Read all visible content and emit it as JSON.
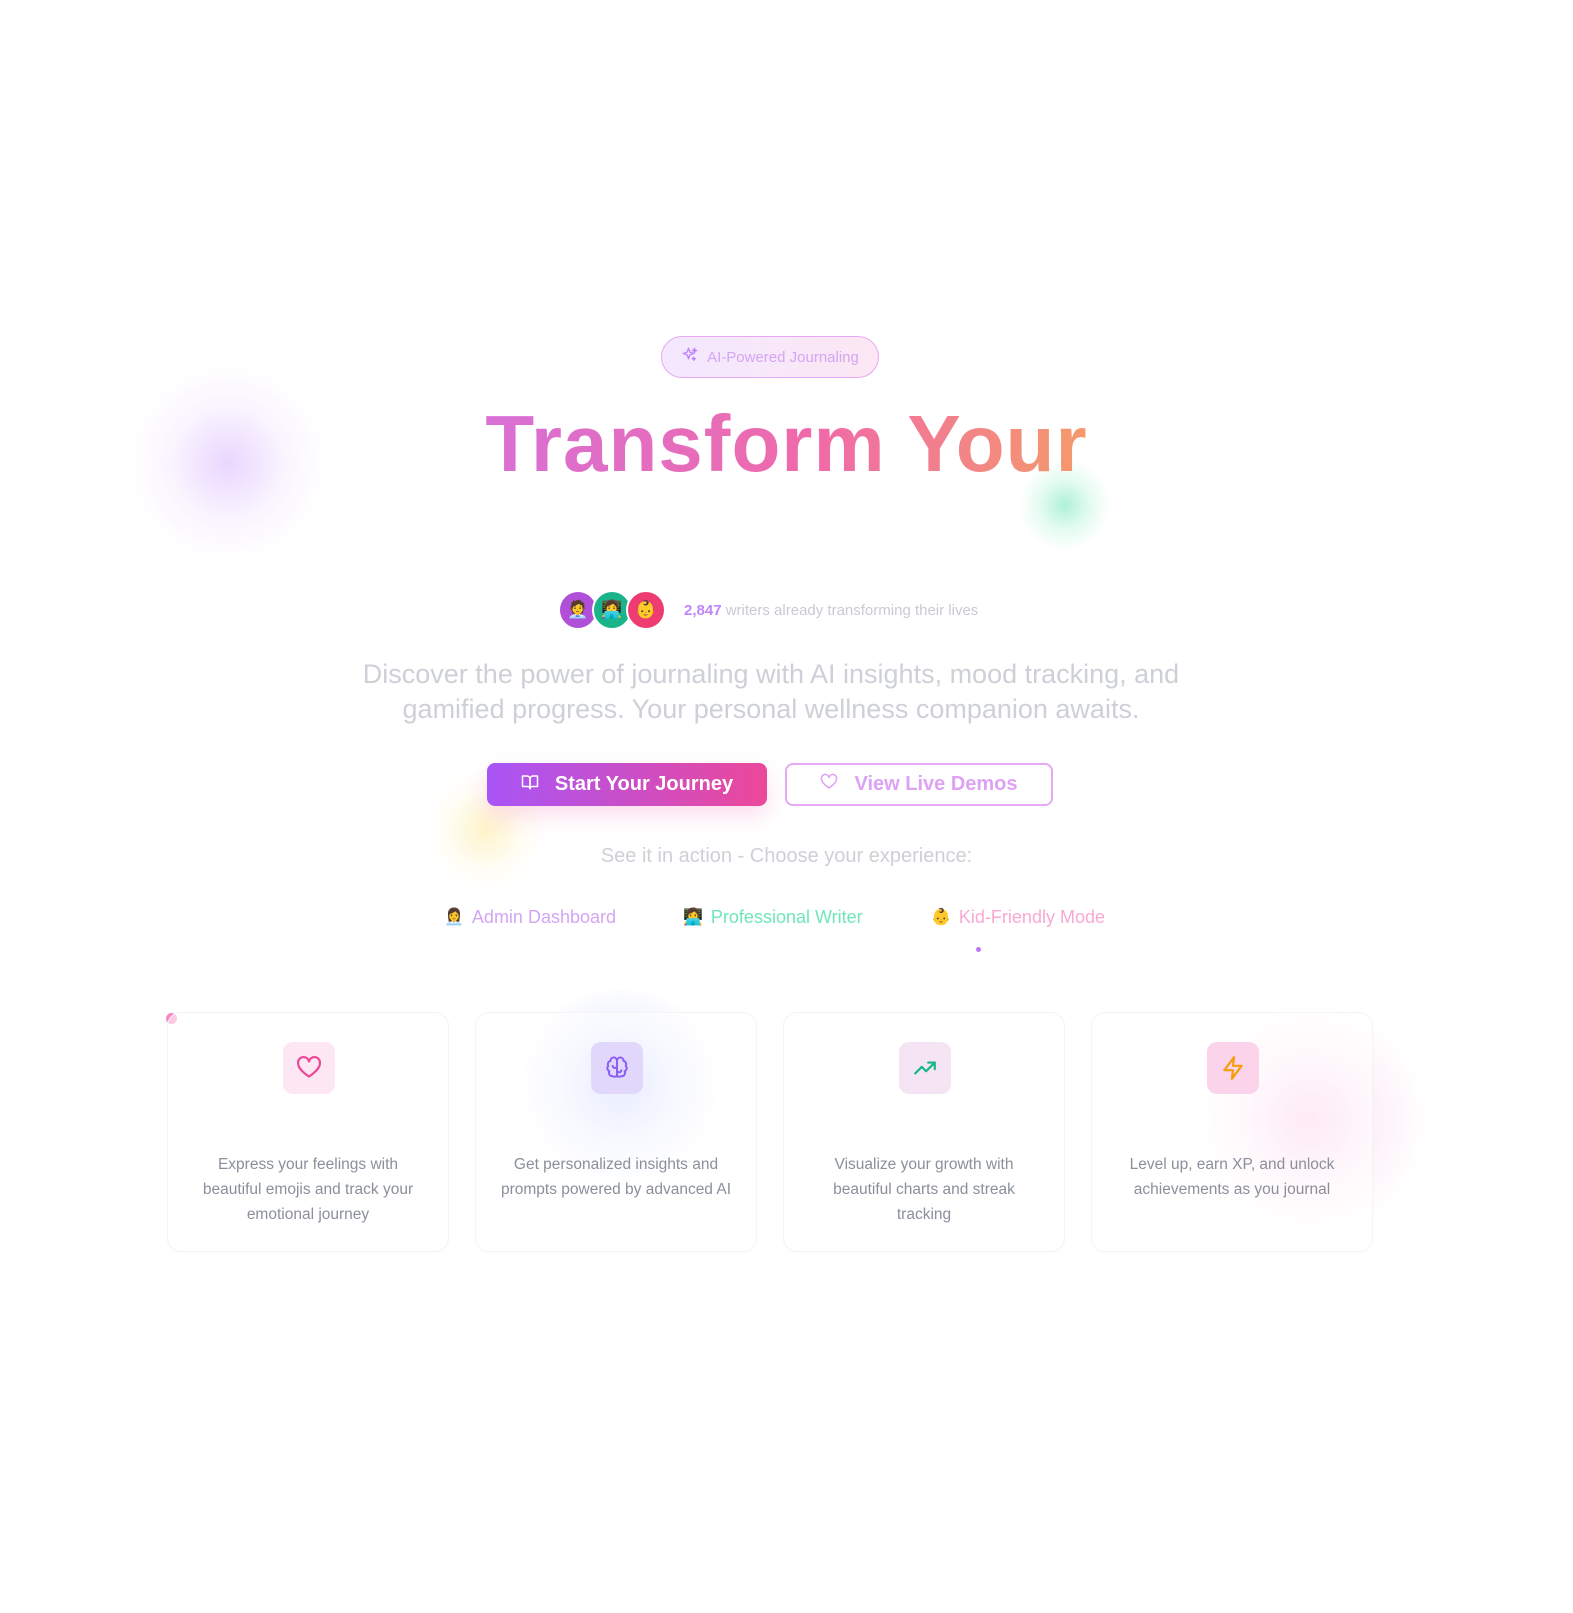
{
  "hero": {
    "badge_label": "AI-Powered Journaling",
    "badge_icon": "sparkles-icon",
    "title": "Transform Your",
    "title_gradient": [
      "#d870d6",
      "#f06aa8",
      "#f59a6b"
    ]
  },
  "social_proof": {
    "avatars": [
      {
        "emoji": "🧑‍💼",
        "color": "#b04fd8"
      },
      {
        "emoji": "👩‍💻",
        "color": "#1ab48a"
      },
      {
        "emoji": "👶",
        "color": "#ee3c72"
      }
    ],
    "count": "2,847",
    "text": "writers already transforming their lives"
  },
  "subtitle": "Discover the power of journaling with AI insights, mood tracking, and gamified progress. Your personal wellness companion awaits.",
  "actions": {
    "primary_label": "Start Your Journey",
    "primary_icon": "book-open-icon",
    "secondary_label": "View Live Demos",
    "secondary_icon": "heart-icon"
  },
  "demos": {
    "prompt": "See it in action - Choose your experience:",
    "items": [
      {
        "emoji": "👩‍💼",
        "label": "Admin Dashboard",
        "color": "#d4a5f3"
      },
      {
        "emoji": "👩‍💻",
        "label": "Professional Writer",
        "color": "#6ee7b7"
      },
      {
        "emoji": "👶",
        "label": "Kid-Friendly Mode",
        "color": "#f9a8d4"
      }
    ]
  },
  "features": [
    {
      "icon": "heart-icon",
      "color": "#ec4899",
      "text": "Express your feelings with beautiful emojis and track your emotional journey"
    },
    {
      "icon": "brain-icon",
      "color": "#8b5cf6",
      "text": "Get personalized insights and prompts powered by advanced AI"
    },
    {
      "icon": "trending-up-icon",
      "color": "#10b981",
      "text": "Visualize your growth with beautiful charts and streak tracking"
    },
    {
      "icon": "lightning-icon",
      "color": "#f59e0b",
      "text": "Level up, earn XP, and unlock achievements as you journal"
    }
  ]
}
